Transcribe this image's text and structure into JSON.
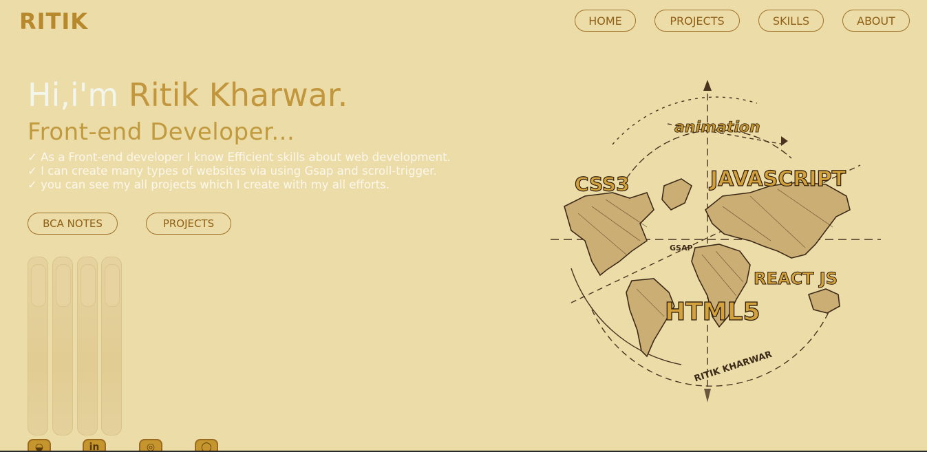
{
  "brand": {
    "logo_text": "RITIK"
  },
  "nav": {
    "items": [
      {
        "label": "HOME"
      },
      {
        "label": "PROJECTS"
      },
      {
        "label": "SKILLS"
      },
      {
        "label": "ABOUT"
      }
    ]
  },
  "hero": {
    "greeting": "Hi,i'm",
    "name": "Ritik Kharwar.",
    "role": "Front-end Developer...",
    "points": [
      "✓ As a Front-end developer I know Efficient skills about web development.",
      "✓ I can create many types of websites via using Gsap and scroll-trigger.",
      "✓ you can see my all projects which I create with my all efforts."
    ],
    "buttons": [
      {
        "label": "BCA NOTES"
      },
      {
        "label": "PROJECTS"
      }
    ]
  },
  "art": {
    "labels": {
      "animation": "animation",
      "css": "CSS3",
      "javascript": "JAVASCRIPT",
      "gsap": "GSAP",
      "react": "REACT JS",
      "html": "HTML5",
      "signature": "RITIK KHARWAR"
    }
  },
  "socials": [
    {
      "icon": "github-icon"
    },
    {
      "icon": "linkedin-icon"
    },
    {
      "icon": "instagram-icon"
    },
    {
      "icon": "whatsapp-icon"
    }
  ],
  "colors": {
    "background": "#ecdca8",
    "accent": "#c1963d",
    "border": "#a07128",
    "text_light": "#fbf7ec"
  }
}
